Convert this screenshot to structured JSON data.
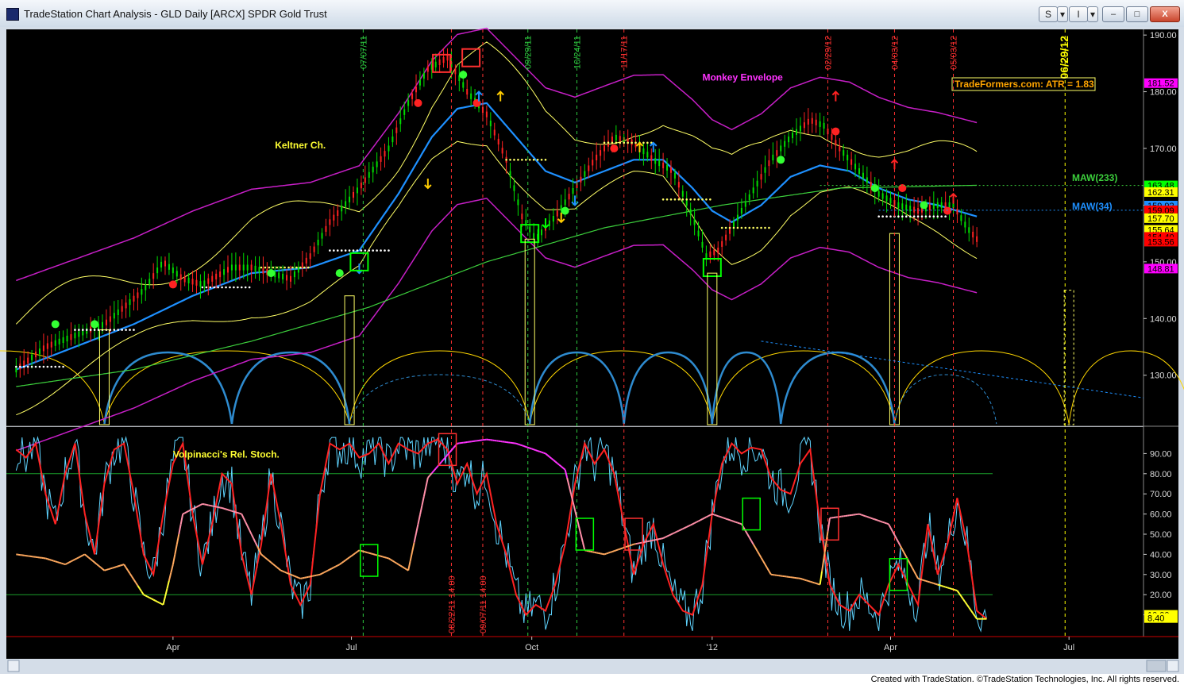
{
  "window": {
    "title": "TradeStation Chart Analysis - GLD Daily [ARCX] SPDR Gold Trust",
    "btn_s": "S",
    "btn_i": "I",
    "btn_caret": "▾",
    "min": "–",
    "max": "□",
    "close": "X"
  },
  "footer": "Created with TradeStation. ©TradeStation Technologies, Inc. All rights reserved.",
  "chart_data": {
    "type": "line",
    "price_axis": {
      "ticks": [
        "190.00",
        "180.00",
        "170.00",
        "160.00",
        "150.00",
        "140.00",
        "130.00"
      ],
      "values": [
        190,
        180,
        170,
        160,
        150,
        140,
        130
      ],
      "range": [
        121,
        191
      ]
    },
    "osc_axis": {
      "ticks": [
        "90.00",
        "80.00",
        "70.00",
        "60.00",
        "50.00",
        "40.00",
        "30.00",
        "20.00",
        "10.00"
      ],
      "values": [
        90,
        80,
        70,
        60,
        50,
        40,
        30,
        20,
        10
      ],
      "range": [
        0,
        100
      ]
    },
    "x_labels": [
      {
        "label": "Apr",
        "day": 80
      },
      {
        "label": "Jul",
        "day": 171
      },
      {
        "label": "Oct",
        "day": 263
      },
      {
        "label": "'12",
        "day": 355
      },
      {
        "label": "Apr",
        "day": 446
      },
      {
        "label": "Jul",
        "day": 537
      }
    ],
    "annotations": {
      "monkey": "Monkey Envelope",
      "keltner": "Keltner Ch.",
      "atr": "TradeFormers.com: ATR = 1.83",
      "maw233": "MAW(233)",
      "maw34": "MAW(34)",
      "stoch": "Volpinacci's Rel. Stoch."
    },
    "date_lines": [
      {
        "label": "07/07/11",
        "day": 177,
        "color": "#2ecc40"
      },
      {
        "label": "09/29/11",
        "day": 261,
        "color": "#2ecc40"
      },
      {
        "label": "10/24/11",
        "day": 286,
        "color": "#2ecc40"
      },
      {
        "label": "11/17/11",
        "day": 310,
        "color": "#ff3030"
      },
      {
        "label": "02/29/12",
        "day": 414,
        "color": "#ff3030"
      },
      {
        "label": "04/03/12",
        "day": 448,
        "color": "#ff3030"
      },
      {
        "label": "05/03/12",
        "day": 478,
        "color": "#ff3030"
      },
      {
        "label": "06/29/12",
        "day": 535,
        "color": "#ffff00"
      }
    ],
    "osc_date_lines": [
      {
        "label": "08/22/11 14:00",
        "day": 222
      },
      {
        "label": "09/07/11 14:00",
        "day": 238
      }
    ],
    "price_badges": [
      {
        "label": "181.52",
        "value": 181.52,
        "bg": "#ff00ff",
        "fg": "#000"
      },
      {
        "label": "163.48",
        "value": 163.48,
        "bg": "#00ff00",
        "fg": "#000"
      },
      {
        "label": "162.31",
        "value": 162.31,
        "bg": "#ffff00",
        "fg": "#000"
      },
      {
        "label": "159.92",
        "value": 159.92,
        "bg": "#1e90ff",
        "fg": "#000"
      },
      {
        "label": "159.09",
        "value": 159.09,
        "bg": "#ff0000",
        "fg": "#000"
      },
      {
        "label": "157.70",
        "value": 157.7,
        "bg": "#ffff00",
        "fg": "#000"
      },
      {
        "label": "155.64",
        "value": 155.64,
        "bg": "#ffff00",
        "fg": "#000"
      },
      {
        "label": "154.40",
        "value": 154.4,
        "bg": "#ff0000",
        "fg": "#000"
      },
      {
        "label": "153.56",
        "value": 153.56,
        "bg": "#ff0000",
        "fg": "#000"
      },
      {
        "label": "148.81",
        "value": 148.81,
        "bg": "#ff00ff",
        "fg": "#000"
      }
    ],
    "osc_badges": [
      {
        "label": "10.00",
        "value": 10.0,
        "bg": "#ffff00",
        "fg": "#000"
      },
      {
        "label": "8.40",
        "value": 8.4,
        "bg": "#ffff00",
        "fg": "#000"
      }
    ],
    "price_anchors": [
      [
        0,
        131
      ],
      [
        15,
        135
      ],
      [
        30,
        137
      ],
      [
        45,
        139
      ],
      [
        55,
        142
      ],
      [
        65,
        145
      ],
      [
        75,
        150
      ],
      [
        85,
        147
      ],
      [
        95,
        146
      ],
      [
        110,
        149
      ],
      [
        120,
        149
      ],
      [
        130,
        148
      ],
      [
        140,
        147
      ],
      [
        150,
        151
      ],
      [
        160,
        157
      ],
      [
        175,
        163
      ],
      [
        190,
        170
      ],
      [
        200,
        178
      ],
      [
        210,
        184
      ],
      [
        220,
        186
      ],
      [
        230,
        180
      ],
      [
        240,
        176
      ],
      [
        250,
        168
      ],
      [
        258,
        158
      ],
      [
        265,
        154
      ],
      [
        275,
        158
      ],
      [
        285,
        163
      ],
      [
        295,
        168
      ],
      [
        305,
        172
      ],
      [
        315,
        171
      ],
      [
        325,
        168
      ],
      [
        335,
        166
      ],
      [
        345,
        158
      ],
      [
        352,
        151
      ],
      [
        358,
        152
      ],
      [
        365,
        156
      ],
      [
        375,
        162
      ],
      [
        385,
        168
      ],
      [
        395,
        172
      ],
      [
        405,
        175
      ],
      [
        412,
        174
      ],
      [
        420,
        170
      ],
      [
        430,
        166
      ],
      [
        440,
        162
      ],
      [
        450,
        160
      ],
      [
        460,
        159
      ],
      [
        470,
        160
      ],
      [
        478,
        160
      ],
      [
        485,
        156
      ],
      [
        490,
        154
      ]
    ],
    "ma34_anchors": [
      [
        0,
        131
      ],
      [
        30,
        135
      ],
      [
        60,
        139
      ],
      [
        90,
        144
      ],
      [
        120,
        148
      ],
      [
        150,
        149
      ],
      [
        175,
        152
      ],
      [
        195,
        162
      ],
      [
        212,
        172
      ],
      [
        225,
        177
      ],
      [
        240,
        178
      ],
      [
        255,
        172
      ],
      [
        270,
        166
      ],
      [
        285,
        164
      ],
      [
        300,
        166
      ],
      [
        315,
        168
      ],
      [
        330,
        168
      ],
      [
        345,
        163
      ],
      [
        355,
        159
      ],
      [
        365,
        157
      ],
      [
        380,
        160
      ],
      [
        395,
        165
      ],
      [
        410,
        167
      ],
      [
        425,
        166
      ],
      [
        440,
        163
      ],
      [
        455,
        161
      ],
      [
        470,
        160
      ],
      [
        490,
        158
      ]
    ],
    "ma233_anchors": [
      [
        0,
        128
      ],
      [
        60,
        131
      ],
      [
        120,
        136
      ],
      [
        180,
        142
      ],
      [
        240,
        150
      ],
      [
        300,
        156
      ],
      [
        360,
        160
      ],
      [
        420,
        163
      ],
      [
        490,
        163.5
      ]
    ],
    "stoch_anchors": [
      [
        0,
        92
      ],
      [
        5,
        88
      ],
      [
        10,
        95
      ],
      [
        15,
        70
      ],
      [
        20,
        55
      ],
      [
        25,
        80
      ],
      [
        30,
        95
      ],
      [
        35,
        60
      ],
      [
        40,
        40
      ],
      [
        45,
        75
      ],
      [
        50,
        92
      ],
      [
        55,
        95
      ],
      [
        60,
        70
      ],
      [
        65,
        40
      ],
      [
        70,
        30
      ],
      [
        75,
        60
      ],
      [
        80,
        85
      ],
      [
        85,
        95
      ],
      [
        90,
        60
      ],
      [
        95,
        35
      ],
      [
        100,
        55
      ],
      [
        105,
        80
      ],
      [
        110,
        75
      ],
      [
        115,
        40
      ],
      [
        120,
        20
      ],
      [
        125,
        45
      ],
      [
        130,
        80
      ],
      [
        135,
        55
      ],
      [
        140,
        25
      ],
      [
        145,
        15
      ],
      [
        150,
        25
      ],
      [
        155,
        70
      ],
      [
        160,
        95
      ],
      [
        165,
        92
      ],
      [
        170,
        95
      ],
      [
        175,
        88
      ],
      [
        180,
        90
      ],
      [
        185,
        95
      ],
      [
        190,
        85
      ],
      [
        195,
        95
      ],
      [
        200,
        92
      ],
      [
        205,
        90
      ],
      [
        210,
        95
      ],
      [
        215,
        97
      ],
      [
        220,
        92
      ],
      [
        225,
        75
      ],
      [
        230,
        85
      ],
      [
        235,
        70
      ],
      [
        240,
        80
      ],
      [
        245,
        55
      ],
      [
        250,
        40
      ],
      [
        255,
        20
      ],
      [
        260,
        10
      ],
      [
        265,
        15
      ],
      [
        270,
        12
      ],
      [
        275,
        25
      ],
      [
        280,
        45
      ],
      [
        285,
        75
      ],
      [
        290,
        95
      ],
      [
        295,
        85
      ],
      [
        300,
        92
      ],
      [
        305,
        80
      ],
      [
        310,
        55
      ],
      [
        315,
        30
      ],
      [
        320,
        45
      ],
      [
        325,
        55
      ],
      [
        330,
        35
      ],
      [
        335,
        20
      ],
      [
        340,
        12
      ],
      [
        345,
        10
      ],
      [
        350,
        25
      ],
      [
        355,
        60
      ],
      [
        360,
        85
      ],
      [
        365,
        95
      ],
      [
        370,
        90
      ],
      [
        375,
        93
      ],
      [
        380,
        92
      ],
      [
        385,
        78
      ],
      [
        390,
        72
      ],
      [
        395,
        70
      ],
      [
        400,
        85
      ],
      [
        405,
        92
      ],
      [
        410,
        55
      ],
      [
        415,
        25
      ],
      [
        420,
        15
      ],
      [
        425,
        12
      ],
      [
        430,
        20
      ],
      [
        435,
        15
      ],
      [
        440,
        10
      ],
      [
        445,
        25
      ],
      [
        450,
        35
      ],
      [
        455,
        25
      ],
      [
        460,
        15
      ],
      [
        465,
        55
      ],
      [
        470,
        30
      ],
      [
        475,
        45
      ],
      [
        480,
        68
      ],
      [
        485,
        45
      ],
      [
        490,
        12
      ],
      [
        495,
        8
      ]
    ],
    "relstoch_anchors": [
      [
        0,
        40
      ],
      [
        15,
        38
      ],
      [
        25,
        35
      ],
      [
        35,
        40
      ],
      [
        45,
        32
      ],
      [
        55,
        35
      ],
      [
        65,
        20
      ],
      [
        75,
        15
      ],
      [
        80,
        35
      ],
      [
        85,
        60
      ],
      [
        95,
        65
      ],
      [
        105,
        63
      ],
      [
        115,
        60
      ],
      [
        125,
        40
      ],
      [
        135,
        32
      ],
      [
        145,
        28
      ],
      [
        155,
        30
      ],
      [
        165,
        35
      ],
      [
        175,
        42
      ],
      [
        190,
        38
      ],
      [
        200,
        32
      ],
      [
        210,
        78
      ],
      [
        225,
        95
      ],
      [
        240,
        97
      ],
      [
        255,
        95
      ],
      [
        270,
        90
      ],
      [
        280,
        82
      ],
      [
        290,
        42
      ],
      [
        300,
        40
      ],
      [
        315,
        45
      ],
      [
        330,
        48
      ],
      [
        345,
        55
      ],
      [
        355,
        60
      ],
      [
        370,
        55
      ],
      [
        385,
        30
      ],
      [
        400,
        28
      ],
      [
        410,
        25
      ],
      [
        415,
        58
      ],
      [
        430,
        60
      ],
      [
        445,
        55
      ],
      [
        460,
        28
      ],
      [
        470,
        25
      ],
      [
        480,
        22
      ],
      [
        490,
        8
      ],
      [
        495,
        8
      ]
    ],
    "cycles": [
      {
        "start": -60,
        "end": 45,
        "color": "#ffd700",
        "dashed": false
      },
      {
        "start": 45,
        "end": 170,
        "color": "#ffd700",
        "dashed": false
      },
      {
        "start": 170,
        "end": 262,
        "color": "#ffd700",
        "dashed": false
      },
      {
        "start": 262,
        "end": 355,
        "color": "#ffd700",
        "dashed": false
      },
      {
        "start": 355,
        "end": 448,
        "color": "#ffd700",
        "dashed": false
      },
      {
        "start": 448,
        "end": 537,
        "color": "#ffd700",
        "dashed": false
      },
      {
        "start": 537,
        "end": 600,
        "color": "#ffd700",
        "dashed": false
      },
      {
        "start": 45,
        "end": 110,
        "color": "#2e8bcf",
        "dashed": false
      },
      {
        "start": 110,
        "end": 170,
        "color": "#2e8bcf",
        "dashed": false
      },
      {
        "start": 262,
        "end": 310,
        "color": "#2e8bcf",
        "dashed": false
      },
      {
        "start": 310,
        "end": 355,
        "color": "#2e8bcf",
        "dashed": false
      },
      {
        "start": 170,
        "end": 262,
        "color": "#2e8bcf",
        "dashed": true
      },
      {
        "start": 355,
        "end": 390,
        "color": "#2e8bcf",
        "dashed": false
      },
      {
        "start": 390,
        "end": 448,
        "color": "#2e8bcf",
        "dashed": false
      },
      {
        "start": 448,
        "end": 500,
        "color": "#2e8bcf",
        "dashed": true
      }
    ],
    "signal_boxes": [
      {
        "day": 175,
        "price": 150,
        "color": "#00ff00"
      },
      {
        "day": 262,
        "price": 155,
        "color": "#00ff00"
      },
      {
        "day": 355,
        "price": 149,
        "color": "#00ff00"
      },
      {
        "day": 217,
        "price": 185,
        "color": "#ff3030"
      },
      {
        "day": 232,
        "price": 186,
        "color": "#ff3030"
      }
    ],
    "osc_boxes": [
      {
        "day": 180,
        "value": 37,
        "color": "#00ff00"
      },
      {
        "day": 220,
        "value": 92,
        "color": "#ff3030"
      },
      {
        "day": 290,
        "value": 50,
        "color": "#00ff00"
      },
      {
        "day": 315,
        "value": 50,
        "color": "#ff3030"
      },
      {
        "day": 375,
        "value": 60,
        "color": "#00ff00"
      },
      {
        "day": 415,
        "value": 55,
        "color": "#ff3030"
      },
      {
        "day": 450,
        "value": 30,
        "color": "#00ff00"
      }
    ]
  }
}
